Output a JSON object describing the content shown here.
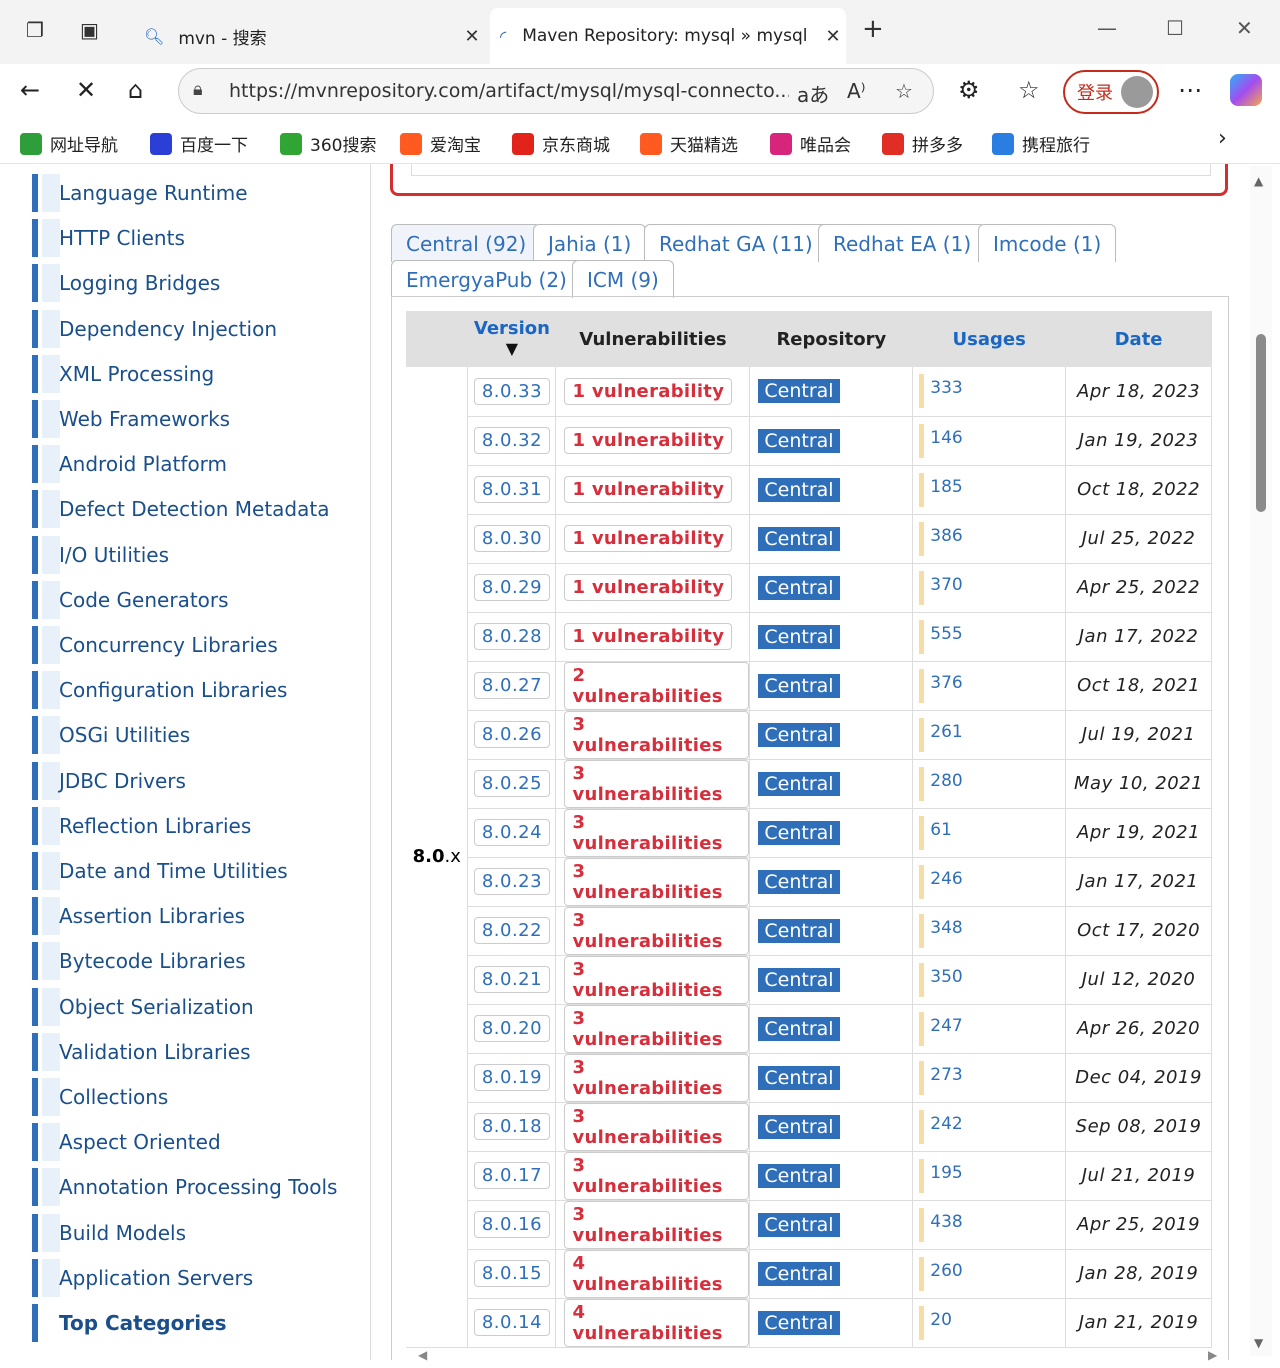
{
  "browser": {
    "tabs": [
      {
        "title": "mvn - 搜索",
        "icon": "search-icon"
      },
      {
        "title": "Maven Repository: mysql » mysql",
        "icon": "loading-icon"
      }
    ],
    "url": "https://mvnrepository.com/artifact/mysql/mysql-connecto...",
    "login_label": "登录",
    "bookmarks": [
      {
        "label": "网址导航",
        "color": "#2e9e3a"
      },
      {
        "label": "百度一下",
        "color": "#2b3fd6"
      },
      {
        "label": "360搜索",
        "color": "#31a533"
      },
      {
        "label": "爱淘宝",
        "color": "#ff5a1f"
      },
      {
        "label": "京东商城",
        "color": "#e2231a"
      },
      {
        "label": "天猫精选",
        "color": "#ff5a1f"
      },
      {
        "label": "唯品会",
        "color": "#d6257a"
      },
      {
        "label": "拼多多",
        "color": "#e02e24"
      },
      {
        "label": "携程旅行",
        "color": "#2a7de1"
      }
    ]
  },
  "sidebar": {
    "items": [
      "Language Runtime",
      "HTTP Clients",
      "Logging Bridges",
      "Dependency Injection",
      "XML Processing",
      "Web Frameworks",
      "Android Platform",
      "Defect Detection Metadata",
      "I/O Utilities",
      "Code Generators",
      "Concurrency Libraries",
      "Configuration Libraries",
      "OSGi Utilities",
      "JDBC Drivers",
      "Reflection Libraries",
      "Date and Time Utilities",
      "Assertion Libraries",
      "Bytecode Libraries",
      "Object Serialization",
      "Validation Libraries",
      "Collections",
      "Aspect Oriented",
      "Annotation Processing Tools",
      "Build Models",
      "Application Servers"
    ],
    "footer": "Top Categories"
  },
  "repo_tabs": {
    "row1": [
      "Central (92)",
      "Jahia (1)",
      "Redhat GA (11)",
      "Redhat EA (1)",
      "Imcode (1)"
    ],
    "row2": [
      "EmergyaPub (2)",
      "ICM (9)"
    ]
  },
  "table": {
    "headers": {
      "version": "Version",
      "sort": "▼",
      "vulnerabilities": "Vulnerabilities",
      "repository": "Repository",
      "usages": "Usages",
      "date": "Date"
    },
    "group_label_bold": "8.0",
    "group_label_rest": ".x",
    "rows": [
      {
        "version": "8.0.33",
        "vuln": "1 vulnerability",
        "repo": "Central",
        "usages": "333",
        "date": "Apr 18, 2023"
      },
      {
        "version": "8.0.32",
        "vuln": "1 vulnerability",
        "repo": "Central",
        "usages": "146",
        "date": "Jan 19, 2023"
      },
      {
        "version": "8.0.31",
        "vuln": "1 vulnerability",
        "repo": "Central",
        "usages": "185",
        "date": "Oct 18, 2022"
      },
      {
        "version": "8.0.30",
        "vuln": "1 vulnerability",
        "repo": "Central",
        "usages": "386",
        "date": "Jul 25, 2022"
      },
      {
        "version": "8.0.29",
        "vuln": "1 vulnerability",
        "repo": "Central",
        "usages": "370",
        "date": "Apr 25, 2022"
      },
      {
        "version": "8.0.28",
        "vuln": "1 vulnerability",
        "repo": "Central",
        "usages": "555",
        "date": "Jan 17, 2022"
      },
      {
        "version": "8.0.27",
        "vuln": "2 vulnerabilities",
        "repo": "Central",
        "usages": "376",
        "date": "Oct 18, 2021"
      },
      {
        "version": "8.0.26",
        "vuln": "3 vulnerabilities",
        "repo": "Central",
        "usages": "261",
        "date": "Jul 19, 2021"
      },
      {
        "version": "8.0.25",
        "vuln": "3 vulnerabilities",
        "repo": "Central",
        "usages": "280",
        "date": "May 10, 2021"
      },
      {
        "version": "8.0.24",
        "vuln": "3 vulnerabilities",
        "repo": "Central",
        "usages": "61",
        "date": "Apr 19, 2021"
      },
      {
        "version": "8.0.23",
        "vuln": "3 vulnerabilities",
        "repo": "Central",
        "usages": "246",
        "date": "Jan 17, 2021"
      },
      {
        "version": "8.0.22",
        "vuln": "3 vulnerabilities",
        "repo": "Central",
        "usages": "348",
        "date": "Oct 17, 2020"
      },
      {
        "version": "8.0.21",
        "vuln": "3 vulnerabilities",
        "repo": "Central",
        "usages": "350",
        "date": "Jul 12, 2020"
      },
      {
        "version": "8.0.20",
        "vuln": "3 vulnerabilities",
        "repo": "Central",
        "usages": "247",
        "date": "Apr 26, 2020"
      },
      {
        "version": "8.0.19",
        "vuln": "3 vulnerabilities",
        "repo": "Central",
        "usages": "273",
        "date": "Dec 04, 2019"
      },
      {
        "version": "8.0.18",
        "vuln": "3 vulnerabilities",
        "repo": "Central",
        "usages": "242",
        "date": "Sep 08, 2019"
      },
      {
        "version": "8.0.17",
        "vuln": "3 vulnerabilities",
        "repo": "Central",
        "usages": "195",
        "date": "Jul 21, 2019"
      },
      {
        "version": "8.0.16",
        "vuln": "3 vulnerabilities",
        "repo": "Central",
        "usages": "438",
        "date": "Apr 25, 2019"
      },
      {
        "version": "8.0.15",
        "vuln": "4 vulnerabilities",
        "repo": "Central",
        "usages": "260",
        "date": "Jan 28, 2019"
      },
      {
        "version": "8.0.14",
        "vuln": "4 vulnerabilities",
        "repo": "Central",
        "usages": "20",
        "date": "Jan 21, 2019"
      }
    ]
  }
}
